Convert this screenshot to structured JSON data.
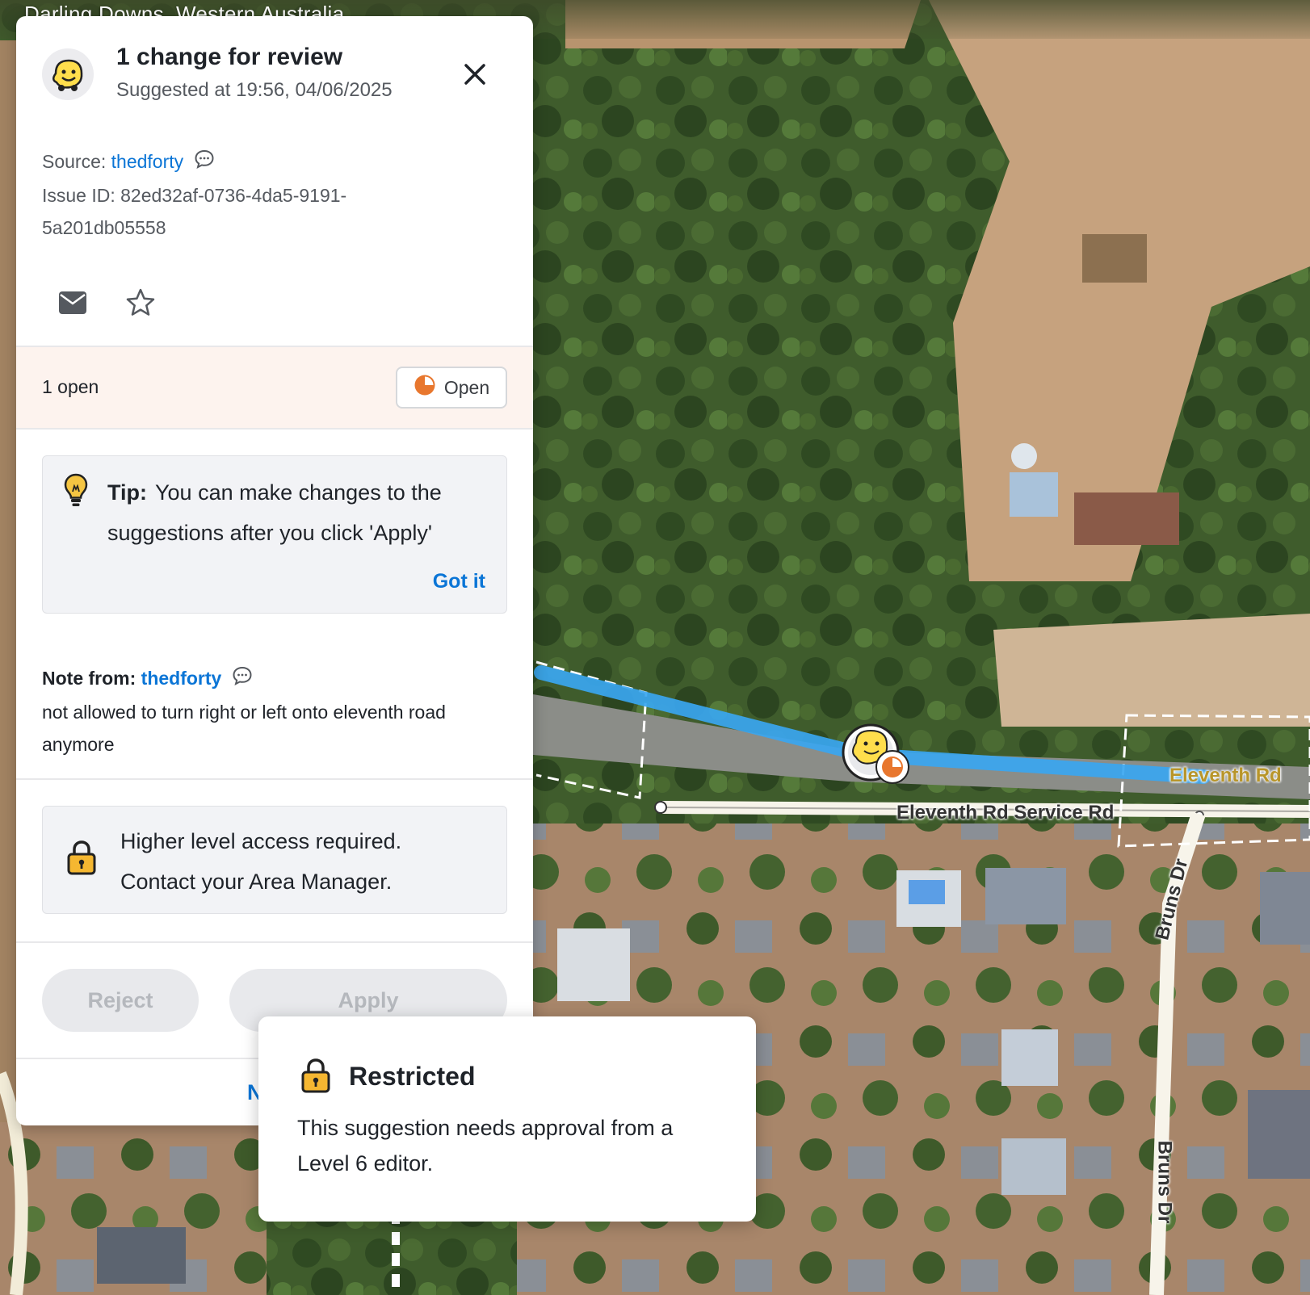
{
  "map": {
    "location": "Darling Downs, Western Australia",
    "roads": {
      "eleventh_rd": "Eleventh Rd",
      "service_rd": "Eleventh Rd Service Rd",
      "bruns_dr": "Bruns Dr"
    }
  },
  "panel": {
    "title": "1 change for review",
    "subtitle": "Suggested at 19:56, 04/06/2025",
    "source_label": "Source:",
    "source_user": "thedforty",
    "issue_line1": "Issue ID: 82ed32af-0736-4da5-9191-",
    "issue_line2": "5a201db05558",
    "status_count": "1 open",
    "status_label": "Open",
    "tip_label": "Tip:",
    "tip_text": "You can make changes to the suggestions after you click 'Apply'",
    "tip_action": "Got it",
    "note_label": "Note from:",
    "note_user": "thedforty",
    "note_text": "not allowed to turn right or left onto eleventh road anymore",
    "access_line1": "Higher level access required.",
    "access_line2": "Contact your Area Manager.",
    "reject_label": "Reject",
    "apply_label": "Apply",
    "next_label": "N"
  },
  "popover": {
    "title": "Restricted",
    "body": "This suggestion needs approval from a Level 6 editor."
  },
  "icons": {
    "avatar": "waze-smiley-icon",
    "close": "close-icon",
    "chat": "chat-bubble-icon",
    "mail": "mail-icon",
    "star": "star-icon",
    "status": "pie-status-icon",
    "tip": "lightbulb-icon",
    "lock": "lock-icon"
  },
  "colors": {
    "link": "#0b75d6",
    "status_orange": "#e8772e",
    "lock_yellow": "#f5b731",
    "segment_blue": "#3aa6f0"
  }
}
